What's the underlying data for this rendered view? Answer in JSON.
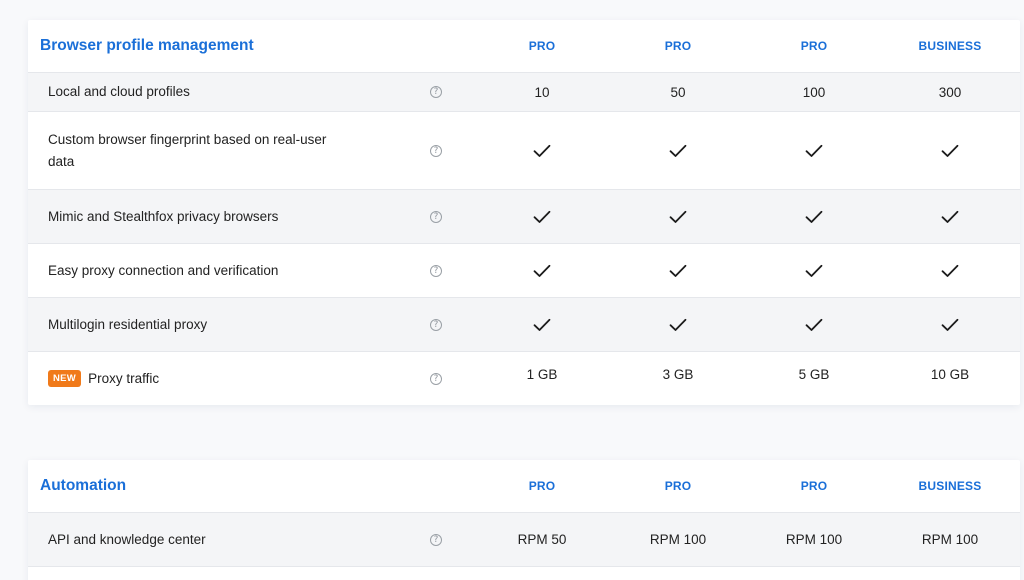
{
  "sections": [
    {
      "title": "Browser profile management",
      "plans": [
        "PRO",
        "PRO",
        "PRO",
        "BUSINESS"
      ],
      "rows": [
        {
          "label": "Local and cloud profiles",
          "values": [
            "10",
            "50",
            "100",
            "300"
          ]
        },
        {
          "label": "Custom browser fingerprint based on real-user data",
          "values": [
            "check",
            "check",
            "check",
            "check"
          ]
        },
        {
          "label": "Mimic and Stealthfox privacy browsers",
          "values": [
            "check",
            "check",
            "check",
            "check"
          ]
        },
        {
          "label": "Easy proxy connection and verification",
          "values": [
            "check",
            "check",
            "check",
            "check"
          ]
        },
        {
          "label": "Multilogin residential proxy",
          "values": [
            "check",
            "check",
            "check",
            "check"
          ]
        },
        {
          "label": "Proxy traffic",
          "badge": "NEW",
          "values": [
            "1 GB",
            "3 GB",
            "5 GB",
            "10 GB"
          ]
        }
      ]
    },
    {
      "title": "Automation",
      "plans": [
        "PRO",
        "PRO",
        "PRO",
        "BUSINESS"
      ],
      "rows": [
        {
          "label": "API and knowledge center",
          "values": [
            "RPM 50",
            "RPM 100",
            "RPM 100",
            "RPM 100"
          ]
        }
      ]
    }
  ],
  "help_glyph": "?",
  "icons": {
    "help": "question-circle-icon",
    "check": "checkmark-icon"
  },
  "colors": {
    "accent": "#1a6fd8",
    "badge": "#f07a1a",
    "row_alt": "#f4f5f7"
  }
}
